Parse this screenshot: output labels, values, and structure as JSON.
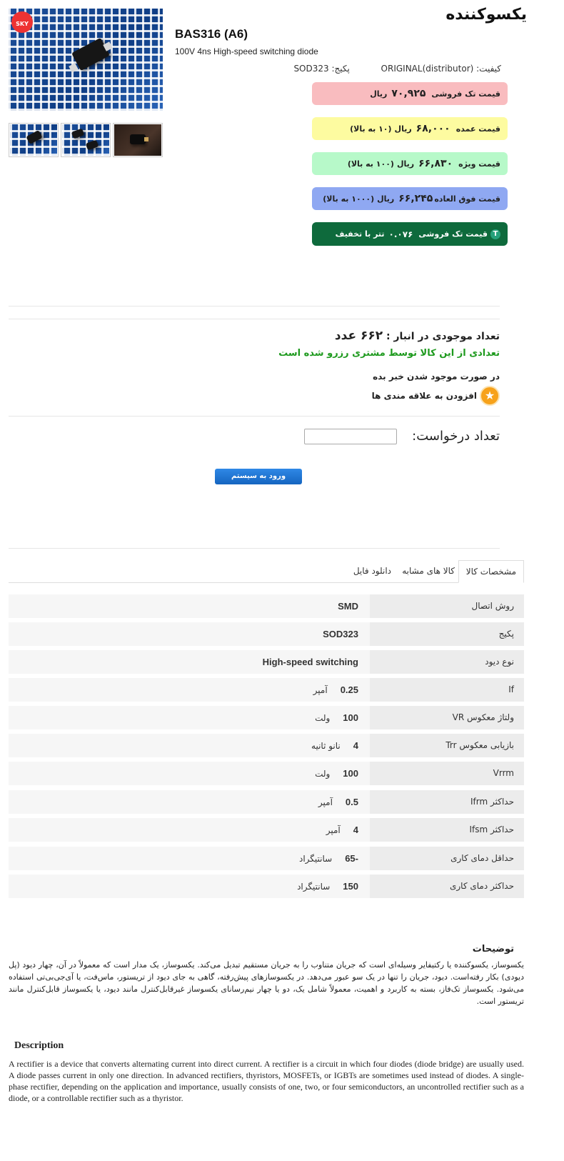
{
  "product": {
    "brand_title": "یکسوکننده",
    "part_number": "BAS316 (A6)",
    "subtitle": "100V 4ns High-speed switching diode",
    "quality_label": "کیفیت:",
    "quality_value": "ORIGINAL(distributor)",
    "package_label": "پکیج:",
    "package_value": "SOD323",
    "logo_text": "SKY"
  },
  "prices": [
    {
      "label": "قیمت تک فروشی",
      "value": "۷۰,۹۲۵",
      "unit": "ریال",
      "note": ""
    },
    {
      "label": "قیمت عمده",
      "value": "۶۸,۰۰۰",
      "unit": "ریال",
      "note": "(۱۰ به بالا)"
    },
    {
      "label": "قیمت ویژه",
      "value": "۶۶,۸۳۰",
      "unit": "ریال",
      "note": "(۱۰۰ به بالا)"
    },
    {
      "label": "قیمت فوق العاده",
      "value": "۶۶,۲۴۵",
      "unit": "ریال",
      "note": "(۱۰۰۰ به بالا)"
    },
    {
      "label": "قیمت تک فروشی",
      "value": "۰.۰۷۶",
      "unit": "تتر با تخفیف",
      "note": ""
    }
  ],
  "stock": {
    "label": "تعداد موجودی در انبار :",
    "count": "۶۶۲ عدد",
    "reserved": "تعدادی از این کالا توسط مشتری رزرو شده است",
    "notify": "در صورت موجود شدن خبر بده",
    "wishlist": "افزودن به علاقه مندی ها"
  },
  "order": {
    "qty_label": "تعداد درخواست:",
    "qty_value": "",
    "login_button": "ورود به سیستم"
  },
  "tabs": [
    {
      "label": "مشخصات کالا",
      "active": true
    },
    {
      "label": "کالا های مشابه",
      "active": false
    },
    {
      "label": "دانلود فایل",
      "active": false
    }
  ],
  "specs": [
    {
      "key": "روش اتصال",
      "value": "SMD",
      "unit": ""
    },
    {
      "key": "پکیج",
      "value": "SOD323",
      "unit": ""
    },
    {
      "key": "نوع دیود",
      "value": "High-speed switching",
      "unit": ""
    },
    {
      "key": "If",
      "value": "0.25",
      "unit": "آمپر"
    },
    {
      "key": "ولتاژ معکوس VR",
      "value": "100",
      "unit": "ولت"
    },
    {
      "key": "بازیابی معکوس Trr",
      "value": "4",
      "unit": "نانو ثانیه"
    },
    {
      "key": "Vrrm",
      "value": "100",
      "unit": "ولت"
    },
    {
      "key": "حداکثر Ifrm",
      "value": "0.5",
      "unit": "آمپر"
    },
    {
      "key": "حداکثر Ifsm",
      "value": "4",
      "unit": "آمپر"
    },
    {
      "key": "حداقل دمای کاری",
      "value": "-65",
      "unit": "سانتیگراد"
    },
    {
      "key": "حداکثر دمای کاری",
      "value": "150",
      "unit": "سانتیگراد"
    }
  ],
  "description": {
    "fa_heading": "توضیحات",
    "fa_text": "یکسوساز، یکسوکننده یا رکتیفایر وسیله‌ای است که جریان متناوب را به جریان مستقیم تبدیل می‌کند. یکسوساز، یک مدار است که معمولاً در آن، چهار دیود (پل دیودی) بکار رفته‌است. دیود، جریان را تنها در یک سو عبور می‌دهد. در یکسوسازهای پیش‌رفته، گاهی به جای دیود از تریستور، ماس‌فت، یا آی‌جی‌بی‌تی استفاده می‌شود. یکسوساز تک‌فاز، بسته به کاربرد و اهمیت، معمولاً شامل یک، دو یا چهار نیم‌رسانای یکسوساز غیرقابل‌کنترل مانند دیود، یا یکسوساز قابل‌کنترل مانند تریستور است.",
    "en_heading": "Description",
    "en_text": "A rectifier is a device that converts alternating current into direct current. A rectifier is a circuit in which four diodes (diode bridge) are usually used. A diode passes current in only one direction. In advanced rectifiers, thyristors, MOSFETs, or IGBTs are sometimes used instead of diodes. A single-phase rectifier, depending on the application and importance, usually consists of one, two, or four semiconductors, an uncontrolled rectifier such as a diode, or a controllable rectifier such as a thyristor."
  },
  "icons": {
    "tether": "T",
    "star": "★"
  }
}
